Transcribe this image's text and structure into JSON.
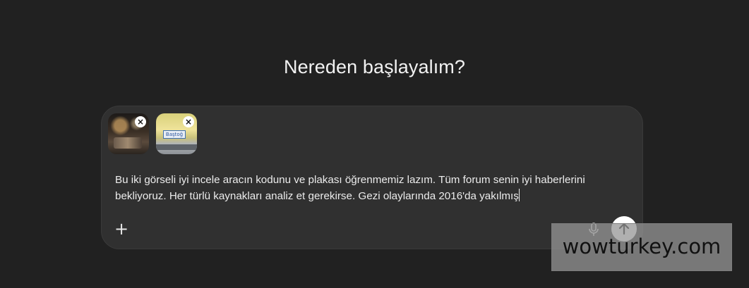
{
  "heading": "Nereden başlayalım?",
  "composer": {
    "attachments": [
      {
        "name": "image-attachment-1",
        "remove_icon": "close-icon"
      },
      {
        "name": "image-attachment-2",
        "remove_icon": "close-icon",
        "sign_text": "Baştoğ"
      }
    ],
    "prompt_text": "Bu iki görseli iyi incele aracın kodunu ve plakası öğrenmemiz lazım. Tüm forum senin iyi haberlerini bekliyoruz. Her türlü kaynakları analiz et gerekirse. Gezi olaylarında 2016'da yakılmış",
    "add_icon": "plus-icon",
    "add_symbol": "+",
    "mic_icon": "microphone-icon",
    "send_icon": "arrow-up-icon",
    "remove_symbol": "×"
  },
  "watermark": "wowturkey.com",
  "colors": {
    "background": "#212121",
    "composer": "#303030",
    "text": "#ececec",
    "send_button": "#ffffff"
  }
}
